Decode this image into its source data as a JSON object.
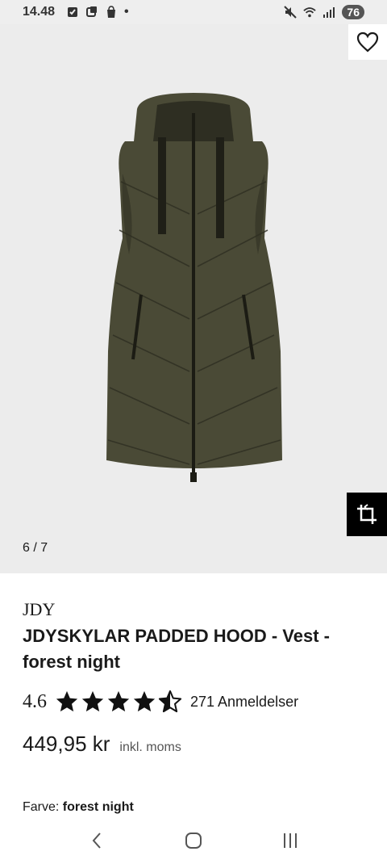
{
  "status_bar": {
    "time": "14.48",
    "battery": "76",
    "dot": "•"
  },
  "gallery": {
    "page_indicator": "6 / 7",
    "image_icon": "padded-vest-image",
    "wishlist_icon": "heart-icon",
    "crop_icon": "crop-icon"
  },
  "product": {
    "brand": "JDY",
    "title": "JDYSKYLAR PADDED HOOD - Vest - forest night",
    "rating": {
      "value": "4.6",
      "stars": 4.6,
      "reviews": "271 Anmeldelser"
    },
    "price": "449,95 kr",
    "vat_note": "inkl. moms",
    "color_label": "Farve:",
    "color_value": "forest night"
  },
  "colors": {
    "vest": "#4a4a36",
    "vest_dark": "#2e2e22",
    "background": "#ececec"
  }
}
